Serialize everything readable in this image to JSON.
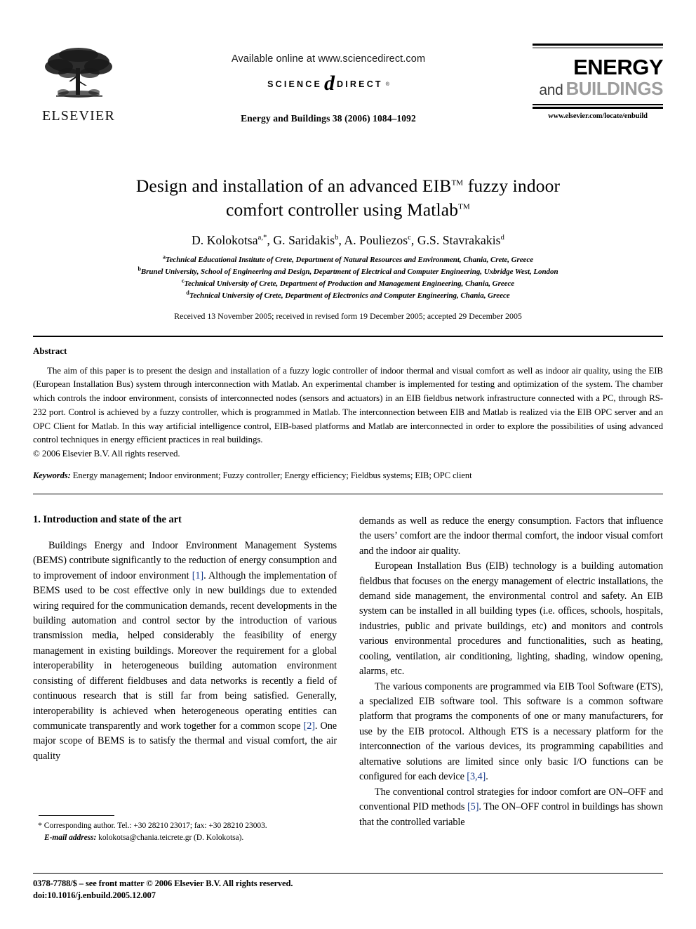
{
  "masthead": {
    "elsevier_wordmark": "ELSEVIER",
    "available_online": "Available online at www.sciencedirect.com",
    "sciencedirect_science": "SCIENCE",
    "sciencedirect_at": "d",
    "sciencedirect_direct": "DIRECT",
    "sciencedirect_tm": "®",
    "journal_reference": "Energy and Buildings 38 (2006) 1084–1092",
    "journal_logo_line1": "ENERGY",
    "journal_logo_and": "and",
    "journal_logo_line2": "BUILDINGS",
    "journal_url": "www.elsevier.com/locate/enbuild",
    "colors": {
      "energy": "#000000",
      "buildings": "#9d9d9d",
      "and": "#3b3b3b",
      "reference_link": "#1a3c8c"
    }
  },
  "title": {
    "line1_pre": "Design and installation of an advanced EIB",
    "line1_tm": "TM",
    "line1_post": " fuzzy indoor",
    "line2_pre": "comfort controller using Matlab",
    "line2_tm": "TM"
  },
  "authors": {
    "list": [
      {
        "name": "D. Kolokotsa",
        "marks": "a,*"
      },
      {
        "name": "G. Saridakis",
        "marks": "b"
      },
      {
        "name": "A. Pouliezos",
        "marks": "c"
      },
      {
        "name": "G.S. Stavrakakis",
        "marks": "d"
      }
    ],
    "affiliations": [
      {
        "mark": "a",
        "text": "Technical Educational Institute of Crete, Department of Natural Resources and Environment, Chania, Crete, Greece"
      },
      {
        "mark": "b",
        "text": "Brunel University, School of Engineering and Design, Department of Electrical and Computer Engineering, Uxbridge West, London"
      },
      {
        "mark": "c",
        "text": "Technical University of Crete, Department of Production and Management Engineering, Chania, Greece"
      },
      {
        "mark": "d",
        "text": "Technical University of Crete, Department of Electronics and Computer Engineering, Chania, Greece"
      }
    ],
    "received": "Received 13 November 2005; received in revised form 19 December 2005; accepted 29 December 2005"
  },
  "abstract": {
    "heading": "Abstract",
    "body": "The aim of this paper is to present the design and installation of a fuzzy logic controller of indoor thermal and visual comfort as well as indoor air quality, using the EIB (European Installation Bus) system through interconnection with Matlab. An experimental chamber is implemented for testing and optimization of the system. The chamber which controls the indoor environment, consists of interconnected nodes (sensors and actuators) in an EIB fieldbus network infrastructure connected with a PC, through RS-232 port. Control is achieved by a fuzzy controller, which is programmed in Matlab. The interconnection between EIB and Matlab is realized via the EIB OPC server and an OPC Client for Matlab. In this way artificial intelligence control, EIB-based platforms and Matlab are interconnected in order to explore the possibilities of using advanced control techniques in energy efficient practices in real buildings.",
    "copyright": "© 2006 Elsevier B.V. All rights reserved.",
    "keywords_label": "Keywords:",
    "keywords_value": "Energy management; Indoor environment; Fuzzy controller; Energy efficiency; Fieldbus systems; EIB; OPC client"
  },
  "main": {
    "section_heading": "1. Introduction and state of the art",
    "left_column": [
      {
        "segments": [
          {
            "text": "Buildings Energy and Indoor Environment Management Systems (BEMS) contribute significantly to the reduction of energy consumption and to improvement of indoor environment "
          },
          {
            "text": "[1]",
            "type": "ref"
          },
          {
            "text": ". Although the implementation of BEMS used to be cost effective only in new buildings due to extended wiring required for the communication demands, recent developments in the building automation and control sector by the introduction of various transmission media, helped considerably the feasibility of energy management in existing buildings. Moreover the requirement for a global interoperability in heterogeneous building automation environment consisting of different fieldbuses and data networks is recently a field of continuous research that is still far from being satisfied. Generally, interoperability is achieved when heterogeneous operating entities can communicate transparently and work together for a common scope "
          },
          {
            "text": "[2]",
            "type": "ref"
          },
          {
            "text": ". One major scope of BEMS is to satisfy the thermal and visual comfort, the air quality"
          }
        ]
      }
    ],
    "right_column": [
      {
        "indent": false,
        "segments": [
          {
            "text": "demands as well as reduce the energy consumption. Factors that influence the users’ comfort are the indoor thermal comfort, the indoor visual comfort and the indoor air quality."
          }
        ]
      },
      {
        "indent": true,
        "segments": [
          {
            "text": "European Installation Bus (EIB) technology is a building automation fieldbus that focuses on the energy management of electric installations, the demand side management, the environmental control and safety. An EIB system can be installed in all building types (i.e. offices, schools, hospitals, industries, public and private buildings, etc) and monitors and controls various environmental procedures and functionalities, such as heating, cooling, ventilation, air conditioning, lighting, shading, window opening, alarms, etc."
          }
        ]
      },
      {
        "indent": true,
        "segments": [
          {
            "text": "The various components are programmed via EIB Tool Software (ETS), a specialized EIB software tool. This software is a common software platform that programs the components of one or many manufacturers, for use by the EIB protocol. Although ETS is a necessary platform for the interconnection of the various devices, its programming capabilities and alternative solutions are limited since only basic I/O functions can be configured for each device "
          },
          {
            "text": "[3,4]",
            "type": "ref"
          },
          {
            "text": "."
          }
        ]
      },
      {
        "indent": true,
        "segments": [
          {
            "text": "The conventional control strategies for indoor comfort are ON–OFF and conventional PID methods "
          },
          {
            "text": "[5]",
            "type": "ref"
          },
          {
            "text": ". The ON–OFF control in buildings has shown that the controlled variable"
          }
        ]
      }
    ]
  },
  "footnote": {
    "corresponding": "Corresponding author. Tel.: +30 28210 23017; fax: +30 28210 23003.",
    "email_label": "E-mail address:",
    "email_value": "kolokotsa@chania.teicrete.gr (D. Kolokotsa)."
  },
  "page_footer": {
    "line1": "0378-7788/$ – see front matter © 2006 Elsevier B.V. All rights reserved.",
    "line2": "doi:10.1016/j.enbuild.2005.12.007"
  }
}
